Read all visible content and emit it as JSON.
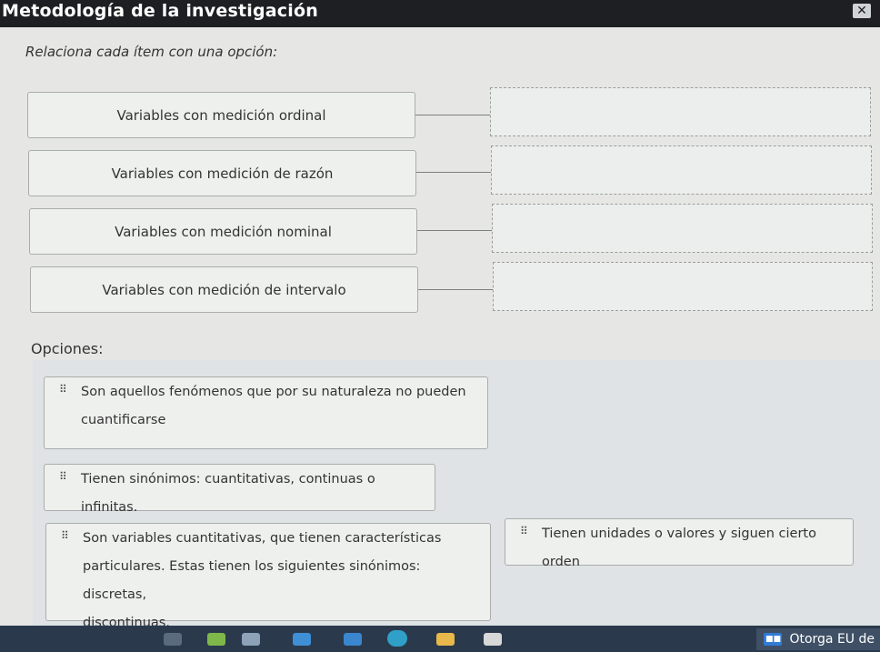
{
  "window": {
    "title": "Metodología de la investigación"
  },
  "instructions": "Relaciona cada ítem con una opción:",
  "items": [
    {
      "label": "Variables con medición ordinal"
    },
    {
      "label": "Variables con medición de razón"
    },
    {
      "label": "Variables con medición nominal"
    },
    {
      "label": "Variables con medición de intervalo"
    }
  ],
  "options_label": "Opciones:",
  "options": [
    {
      "line1": "Son aquellos fenómenos que por su naturaleza no pueden",
      "line2": "cuantificarse",
      "line3": ""
    },
    {
      "line1": "Tienen sinónimos: cuantitativas, continuas o infinitas.",
      "line2": "",
      "line3": ""
    },
    {
      "line1": "Son variables cuantitativas, que tienen características",
      "line2": "particulares. Estas tienen los siguientes sinónimos: discretas,",
      "line3": "discontinuas."
    },
    {
      "line1": "Tienen unidades o valores y siguen cierto orden",
      "line2": "",
      "line3": ""
    }
  ],
  "taskbar": {
    "notification_text": "Otorga EU de"
  },
  "colors": {
    "titlebar": "#1d1f22",
    "taskbar": "#2a3a4c",
    "accent": "#2f7bd6"
  }
}
